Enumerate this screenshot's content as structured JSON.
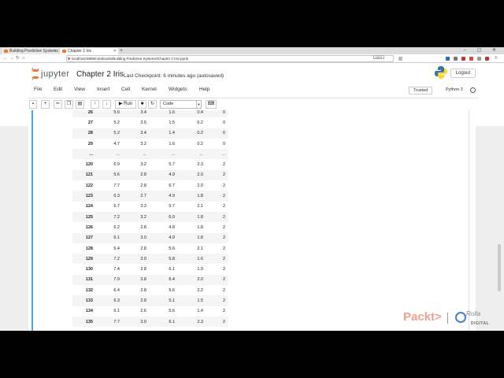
{
  "browser": {
    "tabs": [
      {
        "label": "Building Predictive Systems"
      },
      {
        "label": "Chapter 2 Iris"
      }
    ],
    "new_tab": "+",
    "window_controls": "– ▢ ✕",
    "url": "localhost:8888/notebooks/Building Predictive Systems/Chapter 2 Iris.ipynb",
    "zoom": "110%"
  },
  "jupyter": {
    "logo_text": "jupyter",
    "notebook_name": "Chapter 2 Iris",
    "checkpoint": "Last Checkpoint: 6 minutes ago  (autosaved)",
    "logout_label": "Logout",
    "menus": [
      "File",
      "Edit",
      "View",
      "Insert",
      "Cell",
      "Kernel",
      "Widgets",
      "Help"
    ],
    "trusted_label": "Trusted",
    "kernel_name": "Python 3",
    "toolbar": {
      "run_label": "Run",
      "cell_type": "Code"
    }
  },
  "dataframe": {
    "rows": [
      [
        "26",
        "5.0",
        "3.4",
        "1.6",
        "0.4",
        "0"
      ],
      [
        "27",
        "5.2",
        "3.5",
        "1.5",
        "0.2",
        "0"
      ],
      [
        "28",
        "5.2",
        "3.4",
        "1.4",
        "0.2",
        "0"
      ],
      [
        "29",
        "4.7",
        "3.2",
        "1.6",
        "0.2",
        "0"
      ],
      [
        "...",
        "...",
        "...",
        "...",
        "...",
        "..."
      ],
      [
        "120",
        "6.9",
        "3.2",
        "5.7",
        "2.3",
        "2"
      ],
      [
        "121",
        "5.6",
        "2.8",
        "4.9",
        "2.0",
        "2"
      ],
      [
        "122",
        "7.7",
        "2.8",
        "6.7",
        "2.0",
        "2"
      ],
      [
        "123",
        "6.3",
        "2.7",
        "4.9",
        "1.8",
        "2"
      ],
      [
        "124",
        "6.7",
        "3.3",
        "5.7",
        "2.1",
        "2"
      ],
      [
        "125",
        "7.2",
        "3.2",
        "6.0",
        "1.8",
        "2"
      ],
      [
        "126",
        "6.2",
        "2.8",
        "4.8",
        "1.8",
        "2"
      ],
      [
        "127",
        "6.1",
        "3.0",
        "4.9",
        "1.8",
        "2"
      ],
      [
        "128",
        "6.4",
        "2.8",
        "5.6",
        "2.1",
        "2"
      ],
      [
        "129",
        "7.2",
        "3.0",
        "5.8",
        "1.6",
        "2"
      ],
      [
        "130",
        "7.4",
        "2.8",
        "6.1",
        "1.9",
        "2"
      ],
      [
        "131",
        "7.9",
        "3.8",
        "6.4",
        "2.0",
        "2"
      ],
      [
        "132",
        "6.4",
        "2.8",
        "5.6",
        "2.2",
        "2"
      ],
      [
        "133",
        "6.3",
        "2.8",
        "5.1",
        "1.5",
        "2"
      ],
      [
        "134",
        "6.1",
        "2.6",
        "5.6",
        "1.4",
        "2"
      ],
      [
        "135",
        "7.7",
        "3.0",
        "6.1",
        "2.3",
        "2"
      ]
    ]
  },
  "watermark": {
    "brand": "Packt>",
    "script": "Rolla",
    "digital": "DIGITAL"
  },
  "colors": {
    "jupyter_orange": "#f37626",
    "cell_selected": "#42a5f5"
  }
}
